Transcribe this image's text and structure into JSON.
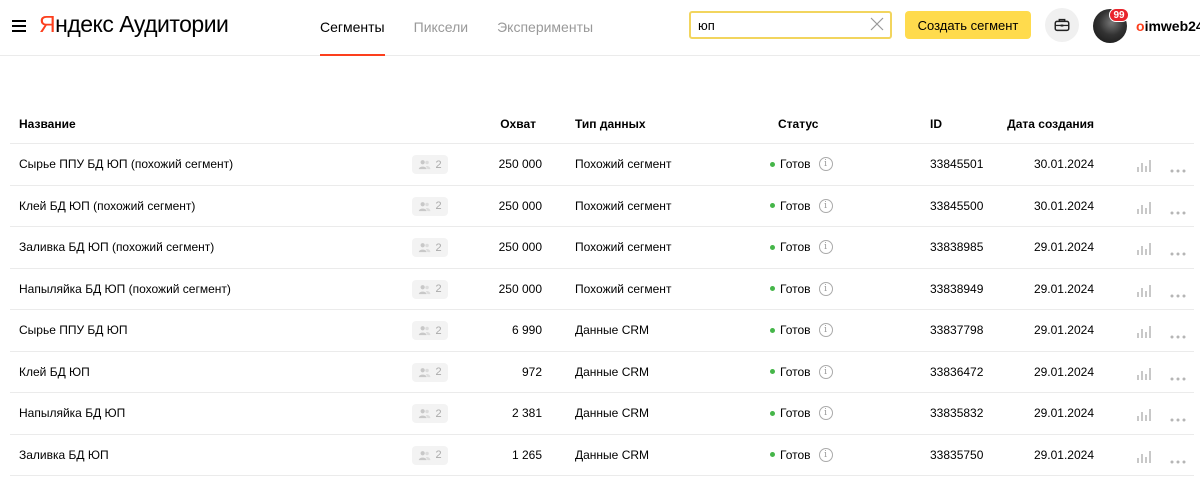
{
  "header": {
    "logo_first": "Я",
    "logo_rest": "ндекс",
    "logo_product": "Аудитории",
    "tabs": [
      {
        "label": "Сегменты",
        "active": true
      },
      {
        "label": "Пиксели",
        "active": false
      },
      {
        "label": "Эксперименты",
        "active": false
      }
    ],
    "search_value": "юп",
    "create_label": "Создать сегмент",
    "notifications_count": "99",
    "user_first": "o",
    "user_rest": "imweb24"
  },
  "table": {
    "columns": {
      "name": "Название",
      "reach": "Охват",
      "type": "Тип данных",
      "status": "Статус",
      "id": "ID",
      "date": "Дата создания"
    },
    "rows": [
      {
        "name": "Сырье ППУ БД ЮП (похожий сегмент)",
        "users": "2",
        "reach": "250 000",
        "type": "Похожий сегмент",
        "status": "Готов",
        "id": "33845501",
        "date": "30.01.2024"
      },
      {
        "name": "Клей БД ЮП (похожий сегмент)",
        "users": "2",
        "reach": "250 000",
        "type": "Похожий сегмент",
        "status": "Готов",
        "id": "33845500",
        "date": "30.01.2024"
      },
      {
        "name": "Заливка БД ЮП (похожий сегмент)",
        "users": "2",
        "reach": "250 000",
        "type": "Похожий сегмент",
        "status": "Готов",
        "id": "33838985",
        "date": "29.01.2024"
      },
      {
        "name": "Напыляйка БД ЮП (похожий сегмент)",
        "users": "2",
        "reach": "250 000",
        "type": "Похожий сегмент",
        "status": "Готов",
        "id": "33838949",
        "date": "29.01.2024"
      },
      {
        "name": "Сырье ППУ БД ЮП",
        "users": "2",
        "reach": "6 990",
        "type": "Данные CRM",
        "status": "Готов",
        "id": "33837798",
        "date": "29.01.2024"
      },
      {
        "name": "Клей БД ЮП",
        "users": "2",
        "reach": "972",
        "type": "Данные CRM",
        "status": "Готов",
        "id": "33836472",
        "date": "29.01.2024"
      },
      {
        "name": "Напыляйка БД ЮП",
        "users": "2",
        "reach": "2 381",
        "type": "Данные CRM",
        "status": "Готов",
        "id": "33835832",
        "date": "29.01.2024"
      },
      {
        "name": "Заливка БД ЮП",
        "users": "2",
        "reach": "1 265",
        "type": "Данные CRM",
        "status": "Готов",
        "id": "33835750",
        "date": "29.01.2024"
      }
    ]
  },
  "colors": {
    "accent_red": "#fc3f1d",
    "button_yellow": "#ffdb4d",
    "search_border": "#f2d55e",
    "status_green": "#45b649",
    "badge_red": "#e9242c"
  },
  "icons": {
    "menu": "burger-menu-icon",
    "clear": "close-icon",
    "case": "briefcase-icon",
    "users": "users-icon",
    "info": "info-icon",
    "stats": "bar-chart-icon",
    "more": "more-dots-icon"
  }
}
